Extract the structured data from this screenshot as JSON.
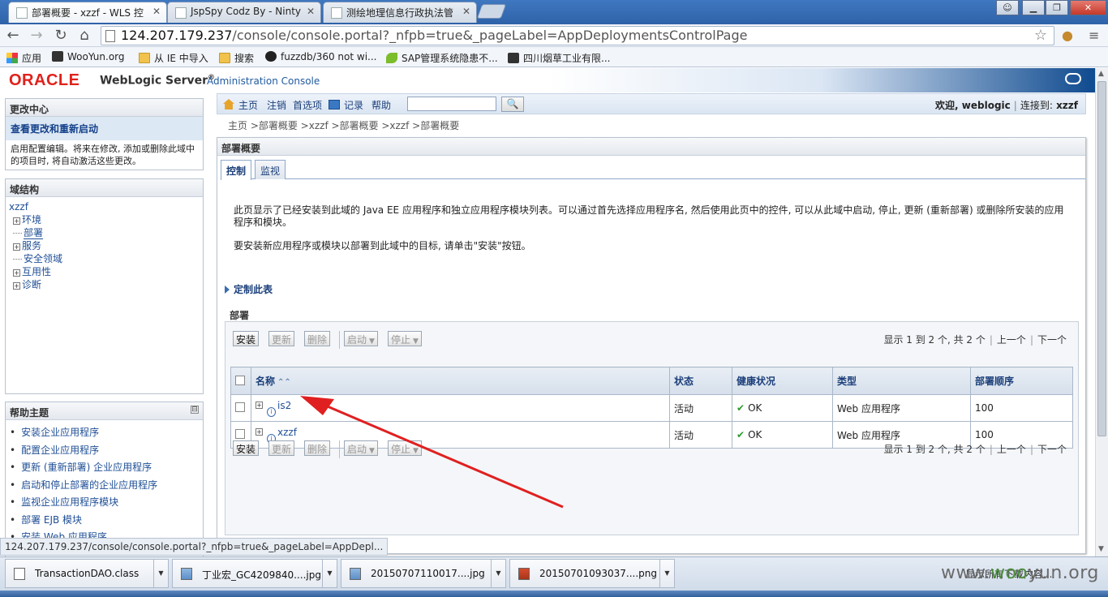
{
  "browser": {
    "tabs": [
      {
        "title": "部署概要 - xzzf - WLS 控"
      },
      {
        "title": "JspSpy Codz By - Ninty"
      },
      {
        "title": "测绘地理信息行政执法管"
      }
    ],
    "address": {
      "host": "124.207.179.237",
      "path": "/console/console.portal?_nfpb=true&_pageLabel=AppDeploymentsControlPage"
    },
    "bookmarks": [
      {
        "label": "应用",
        "icon": "apps-icon"
      },
      {
        "label": "WooYun.org",
        "icon": "wooyun-icon"
      },
      {
        "label": "从 IE 中导入",
        "icon": "folder-icon"
      },
      {
        "label": "搜索",
        "icon": "folder-icon"
      },
      {
        "label": "fuzzdb/360 not wi...",
        "icon": "github-icon"
      },
      {
        "label": "SAP管理系统隐患不...",
        "icon": "leaf-icon"
      },
      {
        "label": "四川烟草工业有限...",
        "icon": "site-icon"
      }
    ],
    "status_url": "124.207.179.237/console/console.portal?_nfpb=true&_pageLabel=AppDepl..."
  },
  "header": {
    "oracle": "ORACLE",
    "product": "WebLogic Server",
    "reg": "®",
    "console": "Administration Console"
  },
  "change_center": {
    "title": "更改中心",
    "link": "查看更改和重新启动",
    "desc": "启用配置编辑。将来在修改, 添加或删除此域中的项目时, 将自动激活这些更改。"
  },
  "domain_structure": {
    "title": "域结构",
    "root": "xzzf",
    "nodes": [
      {
        "label": "环境",
        "expandable": true
      },
      {
        "label": "部署",
        "expandable": false
      },
      {
        "label": "服务",
        "expandable": true
      },
      {
        "label": "安全领域",
        "expandable": false
      },
      {
        "label": "互用性",
        "expandable": true
      },
      {
        "label": "诊断",
        "expandable": true
      }
    ]
  },
  "help_topics": {
    "title": "帮助主题",
    "collapse": "⊟",
    "items": [
      "安装企业应用程序",
      "配置企业应用程序",
      "更新 (重新部署) 企业应用程序",
      "启动和停止部署的企业应用程序",
      "监视企业应用程序模块",
      "部署 EJB 模块",
      "安装 Web 应用程序"
    ]
  },
  "topnav": {
    "home": "主页",
    "logout": "注销",
    "prefs": "首选项",
    "record": "记录",
    "help": "帮助",
    "search_value": "",
    "welcome": "欢迎, weblogic",
    "connected": "连接到:",
    "server": "xzzf"
  },
  "breadcrumb": {
    "text": "主页 >部署概要 >xzzf >部署概要 >xzzf >部署概要"
  },
  "content": {
    "title": "部署概要",
    "tabs": [
      "控制",
      "监视"
    ],
    "intro1": "此页显示了已经安装到此域的 Java EE 应用程序和独立应用程序模块列表。可以通过首先选择应用程序名, 然后使用此页中的控件, 可以从此域中启动, 停止, 更新 (重新部署) 或删除所安装的应用程序和模块。",
    "intro2": "要安装新应用程序或模块以部署到此域中的目标, 请单击\"安装\"按钮。",
    "customize": "定制此表",
    "section": "部署",
    "buttons": {
      "install": "安装",
      "update": "更新",
      "delete": "删除",
      "start": "启动",
      "stop": "停止"
    },
    "pager": {
      "summary": "显示 1 到 2 个, 共 2 个",
      "prev": "上一个",
      "next": "下一个"
    },
    "table": {
      "headers": {
        "name": "名称",
        "state": "状态",
        "health": "健康状况",
        "type": "类型",
        "order": "部署顺序"
      },
      "rows": [
        {
          "name": "is2",
          "state": "活动",
          "health": "OK",
          "type": "Web 应用程序",
          "order": "100"
        },
        {
          "name": "xzzf",
          "state": "活动",
          "health": "OK",
          "type": "Web 应用程序",
          "order": "100"
        }
      ]
    }
  },
  "downloads": [
    {
      "name": "TransactionDAO.class",
      "icon": "file-icon"
    },
    {
      "name": "丁业宏_GC4209840....jpg",
      "icon": "image-icon"
    },
    {
      "name": "20150707110017....jpg",
      "icon": "image-icon"
    },
    {
      "name": "20150701093037....png",
      "icon": "png-icon"
    }
  ],
  "show_all": "显示所有下载内容...",
  "watermark": {
    "a": "www.",
    "b": "woo",
    "c": "yun.org"
  },
  "colors": {
    "oracle_red": "#e0211b",
    "link_blue": "#1f4f96",
    "arrow_red": "#e02020"
  }
}
